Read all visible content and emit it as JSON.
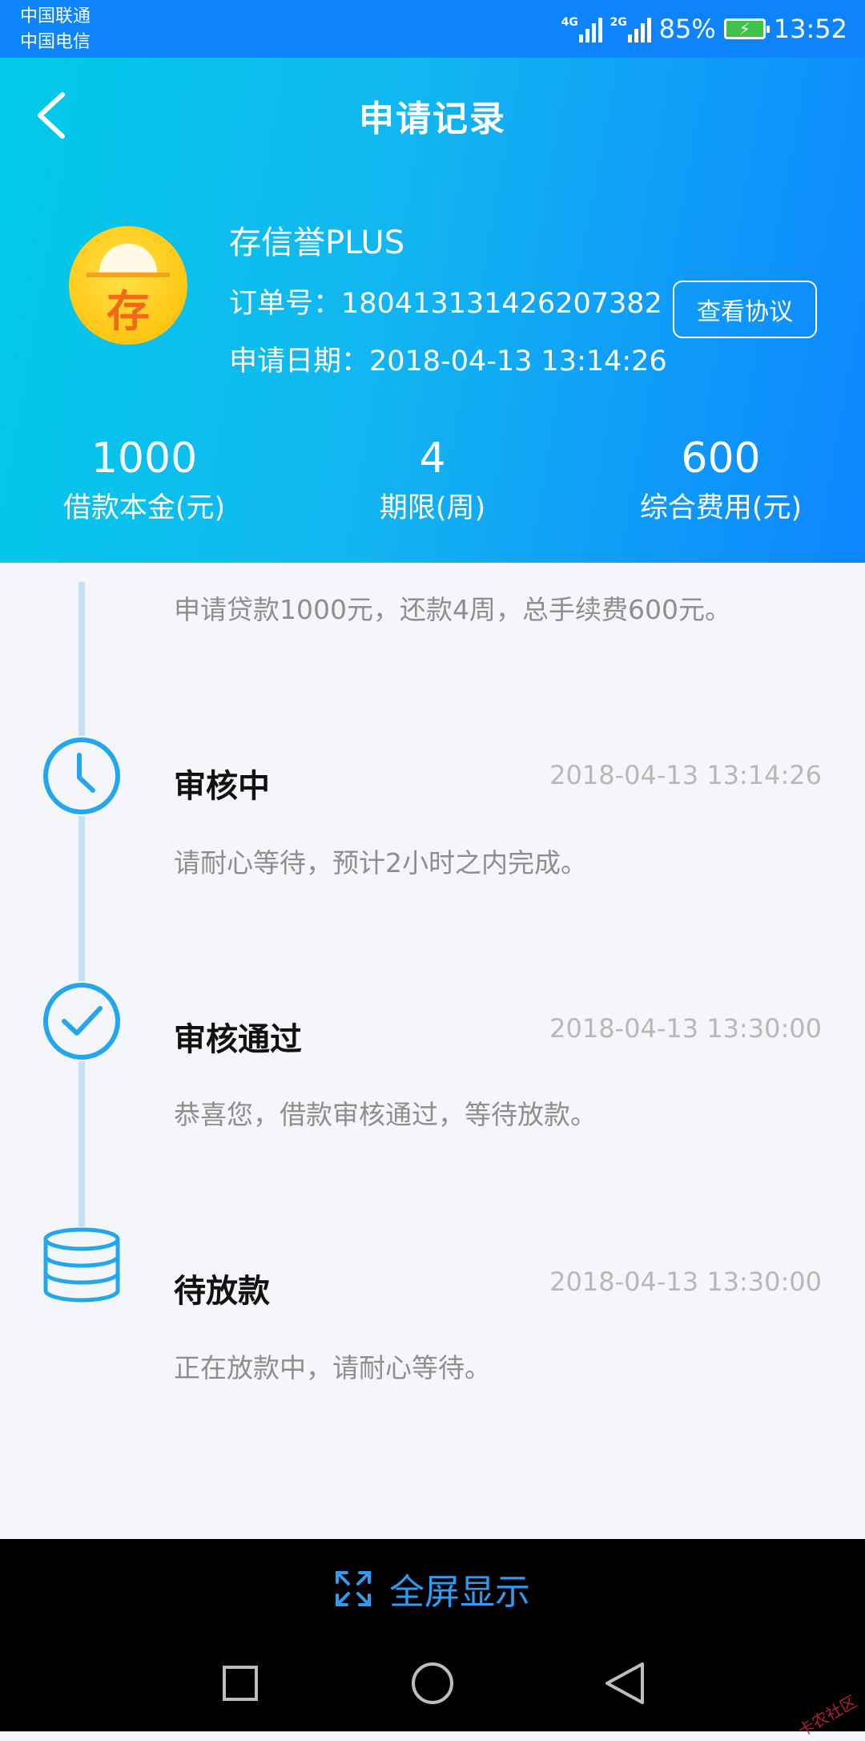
{
  "status_bar": {
    "carrier_1": "中国联通",
    "carrier_2": "中国电信",
    "network_1": "4G",
    "network_2": "2G",
    "battery": "85%",
    "time": "13:52"
  },
  "header": {
    "title": "申请记录",
    "back_icon": "chevron-left-icon"
  },
  "product": {
    "logo_char": "存",
    "name": "存信誉PLUS",
    "order_no": "订单号：180413131426207382",
    "apply_date": "申请日期：2018-04-13 13:14:26",
    "agreement_label": "查看协议"
  },
  "stats": [
    {
      "value": "1000",
      "label": "借款本金(元)"
    },
    {
      "value": "4",
      "label": "期限(周)"
    },
    {
      "value": "600",
      "label": "综合费用(元)"
    }
  ],
  "timeline": {
    "summary": "申请贷款1000元，还款4周，总手续费600元。",
    "steps": [
      {
        "title": "审核中",
        "time": "2018-04-13 13:14:26",
        "desc": "请耐心等待，预计2小时之内完成。",
        "icon": "clock-icon"
      },
      {
        "title": "审核通过",
        "time": "2018-04-13 13:30:00",
        "desc": "恭喜您，借款审核通过，等待放款。",
        "icon": "check-circle-icon"
      },
      {
        "title": "待放款",
        "time": "2018-04-13 13:30:00",
        "desc": "正在放款中，请耐心等待。",
        "icon": "coin-stack-icon"
      }
    ]
  },
  "bottom_bar": {
    "fullscreen_label": "全屏显示",
    "watermark": "卡农社区"
  },
  "colors": {
    "accent": "#1aa4f0",
    "header_start": "#00cbe8",
    "header_end": "#0d86ff",
    "timeline_line": "#c3e1f6"
  }
}
